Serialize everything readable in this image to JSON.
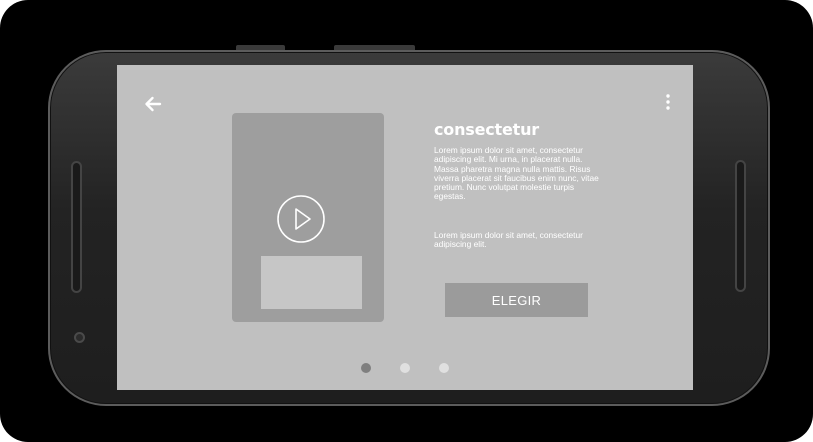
{
  "screen": {
    "title": "consectetur",
    "paragraph_1": "Lorem ipsum dolor sit amet, consectetur adipiscing elit. Mi urna, in placerat nulla. Massa pharetra magna nulla mattis. Risus viverra placerat sit faucibus enim nunc, vitae pretium. Nunc volutpat molestie turpis egestas.",
    "paragraph_2": "Lorem ipsum dolor sit amet, consectetur adipiscing elit.",
    "primary_button": "ELEGIR",
    "icons": {
      "back": "arrow-left-icon",
      "menu": "more-vertical-icon",
      "media": "play-circle-icon"
    },
    "pager": {
      "pages": 3,
      "active_index": 0
    }
  },
  "colors": {
    "screen_background": "#c0c0c0",
    "card": "#9e9e9e",
    "button": "#9b9b9b",
    "text": "#ffffff",
    "dot_active": "#7f7f7f",
    "dot_inactive": "#e0e0e0"
  }
}
